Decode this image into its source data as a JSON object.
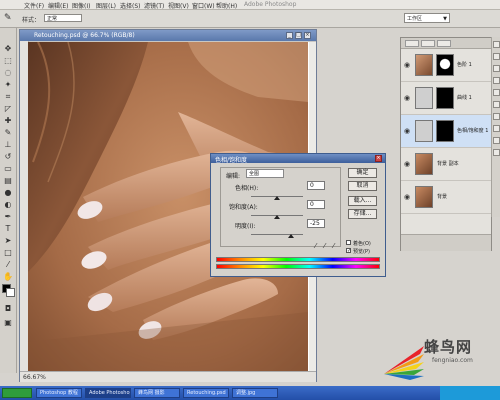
{
  "menubar": {
    "items": [
      "文件(F)",
      "编辑(E)",
      "图像(I)",
      "图层(L)",
      "选择(S)",
      "滤镜(T)",
      "视图(V)",
      "窗口(W)",
      "帮助(H)"
    ],
    "app_title": "Adobe Photoshop"
  },
  "options_bar": {
    "label": "样式：",
    "style_value": "正常",
    "workspace": "工作区"
  },
  "document": {
    "title": "Retouching.psd @ 66.7% (RGB/8)",
    "zoom": "66.67%"
  },
  "layers": [
    {
      "name": "色阶 1"
    },
    {
      "name": "曲线 1"
    },
    {
      "name": "色相/饱和度 1"
    },
    {
      "name": "背景 副本"
    },
    {
      "name": "背景"
    }
  ],
  "dialog": {
    "title": "色相/饱和度",
    "edit_label": "编辑:",
    "edit_value": "全图",
    "hue_label": "色相(H):",
    "hue_value": "0",
    "sat_label": "饱和度(A):",
    "sat_value": "0",
    "light_label": "明度(I):",
    "light_value": "-25",
    "ok_label": "确定",
    "cancel_label": "取消",
    "load_label": "载入...",
    "save_label": "存储...",
    "colorize_label": "着色(O)",
    "preview_label": "预览(P)",
    "colorize_checked": false,
    "preview_checked": true
  },
  "taskbar": {
    "items": [
      "Photoshop 教程",
      "Adobe Photoshop",
      "蜂鸟网 摄影",
      "Retouching.psd",
      "调整.jpg"
    ]
  },
  "watermark": {
    "brand": "蜂鸟网",
    "url": "fengniao.com"
  }
}
